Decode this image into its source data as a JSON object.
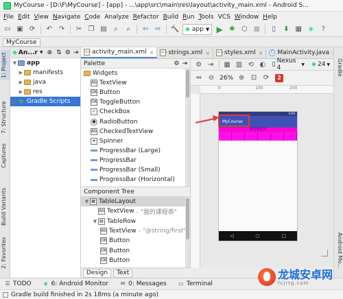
{
  "window": {
    "title": "MyCourse - [D:\\F\\MyCourse] - [app] - ...\\app\\src\\main\\res\\layout\\activity_main.xml - Android S..."
  },
  "menu": [
    {
      "label": "File",
      "u": "F",
      "rest": "ile"
    },
    {
      "label": "Edit",
      "u": "E",
      "rest": "dit"
    },
    {
      "label": "View",
      "u": "V",
      "rest": "iew"
    },
    {
      "label": "Navigate",
      "u": "N",
      "rest": "avigate"
    },
    {
      "label": "Code",
      "u": "C",
      "rest": "ode"
    },
    {
      "label": "Analyze",
      "u": "",
      "rest": "Analyze"
    },
    {
      "label": "Refactor",
      "u": "R",
      "rest": "efactor"
    },
    {
      "label": "Build",
      "u": "B",
      "rest": "uild"
    },
    {
      "label": "Run",
      "u": "R",
      "rest": "un"
    },
    {
      "label": "Tools",
      "u": "T",
      "rest": "ools"
    },
    {
      "label": "VCS",
      "u": "",
      "rest": "VCS"
    },
    {
      "label": "Window",
      "u": "W",
      "rest": "indow"
    },
    {
      "label": "Help",
      "u": "H",
      "rest": "elp"
    }
  ],
  "toolbar": {
    "run_config": "app"
  },
  "breadcrumb": {
    "project": "MyCourse"
  },
  "left_tool_tabs": [
    "1: Project",
    "7: Structure",
    "Captures",
    "Build Variants",
    "2: Favorites"
  ],
  "right_tool_tabs": [
    "Gradle",
    "Android Mo..."
  ],
  "project_panel": {
    "selector": "An...r",
    "tree": [
      {
        "label": "app",
        "level": 0,
        "icon": "folder-blue",
        "expanded": true,
        "bold": true
      },
      {
        "label": "manifests",
        "level": 1,
        "icon": "folder"
      },
      {
        "label": "java",
        "level": 1,
        "icon": "folder"
      },
      {
        "label": "res",
        "level": 1,
        "icon": "folder"
      },
      {
        "label": "Gradle Scripts",
        "level": 0,
        "icon": "gradle",
        "selected": true
      }
    ]
  },
  "editor_tabs": [
    {
      "label": "activity_main.xml",
      "type": "xml",
      "active": true
    },
    {
      "label": "strings.xml",
      "type": "xml"
    },
    {
      "label": "styles.xml",
      "type": "xml"
    },
    {
      "label": "MainActivity.java",
      "type": "java"
    }
  ],
  "palette": {
    "header": "Palette",
    "items": [
      {
        "label": "Widgets",
        "group": true,
        "icon": "folder"
      },
      {
        "label": "TextView",
        "icon": "Ab"
      },
      {
        "label": "Button",
        "icon": "ok"
      },
      {
        "label": "ToggleButton",
        "icon": "ok"
      },
      {
        "label": "CheckBox",
        "icon": "check"
      },
      {
        "label": "RadioButton",
        "icon": "radio"
      },
      {
        "label": "CheckedTextView",
        "icon": "Ab"
      },
      {
        "label": "Spinner",
        "icon": "spin"
      },
      {
        "label": "ProgressBar (Large)",
        "icon": "bar"
      },
      {
        "label": "ProgressBar",
        "icon": "bar"
      },
      {
        "label": "ProgressBar (Small)",
        "icon": "bar"
      },
      {
        "label": "ProgressBar (Horizontal)",
        "icon": "bar"
      }
    ]
  },
  "component_tree": {
    "header": "Component Tree",
    "rows": [
      {
        "label": "TableLayout",
        "hint": "",
        "level": 0,
        "icon": "table",
        "selected": true
      },
      {
        "label": "TextView",
        "hint": "- \"我的课程表\"",
        "level": 1,
        "icon": "Ab"
      },
      {
        "label": "TableRow",
        "hint": "",
        "level": 1,
        "icon": "row",
        "expanded": true
      },
      {
        "label": "TextView",
        "hint": "- \"@string/first\"",
        "level": 2,
        "icon": "Ab"
      },
      {
        "label": "Button",
        "hint": "",
        "level": 2,
        "icon": "ok"
      },
      {
        "label": "Button",
        "hint": "",
        "level": 2,
        "icon": "ok"
      },
      {
        "label": "Button",
        "hint": "",
        "level": 2,
        "icon": "ok"
      }
    ]
  },
  "design_tabs": [
    "Design",
    "Text"
  ],
  "layout_toolbar": {
    "device": "Nexus 4",
    "api": "24",
    "zoom": "26%",
    "warnings": "2"
  },
  "preview": {
    "app_title": "MyCourse",
    "course_label": "我的课程表",
    "status_time": "6:00",
    "accent": "#3f51b5",
    "strip_color": "#ff00d8"
  },
  "bottom_tools": [
    {
      "label": "TODO",
      "icon": "todo-icon"
    },
    {
      "label": "6: Android Monitor",
      "icon": "android-icon"
    },
    {
      "label": "0: Messages",
      "icon": "messages-icon"
    },
    {
      "label": "Terminal",
      "icon": "terminal-icon"
    }
  ],
  "status": {
    "message": "Gradle build finished in 2s 18ms (a minute ago)"
  },
  "watermark": {
    "title": "龙城安卓网",
    "sub": "fcjrtg.com"
  }
}
